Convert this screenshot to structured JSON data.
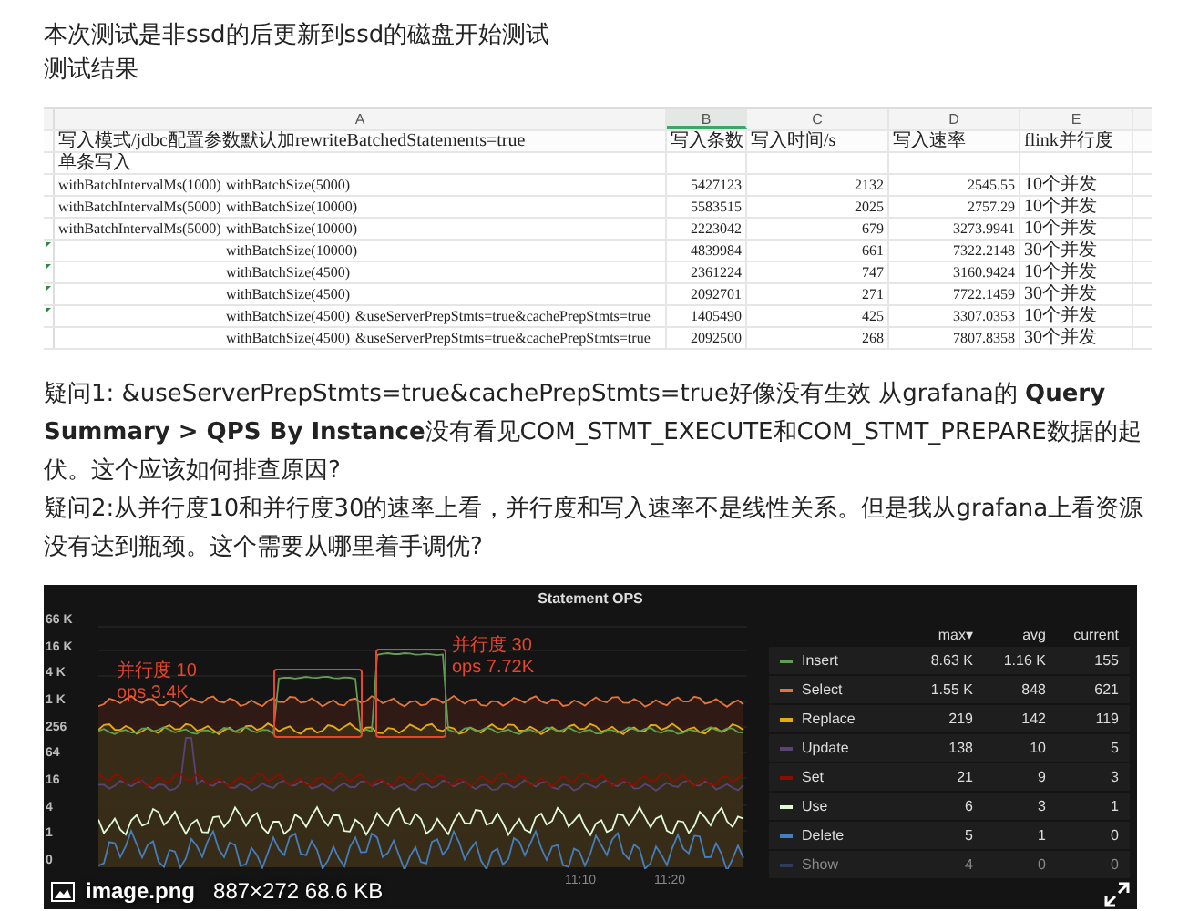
{
  "intro": [
    "本次测试是非ssd的后更新到ssd的磁盘开始测试",
    "测试结果"
  ],
  "sheet": {
    "columns": [
      {
        "label": "A",
        "selected": false
      },
      {
        "label": "B",
        "selected": true
      },
      {
        "label": "C",
        "selected": false
      },
      {
        "label": "D",
        "selected": false
      },
      {
        "label": "E",
        "selected": false
      }
    ],
    "rows": [
      {
        "flagged": false,
        "a": {
          "title": "写入模式/jdbc配置参数默认加rewriteBatchedStatements=true"
        },
        "b": "写入条数",
        "c": "写入时间/s",
        "d": "写入速率",
        "e": "flink并行度",
        "header": true
      },
      {
        "flagged": false,
        "a": {
          "title": "单条写入"
        }
      },
      {
        "flagged": false,
        "a": {
          "interval": "withBatchIntervalMs(1000)",
          "batch": "withBatchSize(5000)"
        },
        "b": "5427123",
        "c": "2132",
        "d": "2545.55",
        "e": "10个并发"
      },
      {
        "flagged": false,
        "a": {
          "interval": "withBatchIntervalMs(5000)",
          "batch": "withBatchSize(10000)"
        },
        "b": "5583515",
        "c": "2025",
        "d": "2757.29",
        "e": "10个并发"
      },
      {
        "flagged": false,
        "a": {
          "interval": "withBatchIntervalMs(5000)",
          "batch": "withBatchSize(10000)"
        },
        "b": "2223042",
        "c": "679",
        "d": "3273.9941",
        "e": "10个并发"
      },
      {
        "flagged": true,
        "a": {
          "batch": "withBatchSize(10000)"
        },
        "b": "4839984",
        "c": "661",
        "d": "7322.2148",
        "e": "30个并发"
      },
      {
        "flagged": true,
        "a": {
          "batch": "withBatchSize(4500)"
        },
        "b": "2361224",
        "c": "747",
        "d": "3160.9424",
        "e": "10个并发"
      },
      {
        "flagged": true,
        "a": {
          "batch": "withBatchSize(4500)"
        },
        "b": "2092701",
        "c": "271",
        "d": "7722.1459",
        "e": "30个并发"
      },
      {
        "flagged": true,
        "a": {
          "batch": "withBatchSize(4500)",
          "options": "&useServerPrepStmts=true&cachePrepStmts=true"
        },
        "b": "1405490",
        "c": "425",
        "d": "3307.0353",
        "e": "10个并发"
      },
      {
        "flagged": false,
        "a": {
          "batch": "withBatchSize(4500)",
          "options": "&useServerPrepStmts=true&cachePrepStmts=true"
        },
        "b": "2092500",
        "c": "268",
        "d": "7807.8358",
        "e": "30个并发"
      }
    ]
  },
  "questions": [
    "疑问1: &useServerPrepStmts=true&cachePrepStmts=true好像没有生效 从grafana的 **Query Summary > QPS By Instance**没有看见COM_STMT_EXECUTE和COM_STMT_PREPARE数据的起伏。这个应该如何排查原因?",
    "疑问2:从并行度10和并行度30的速率上看，并行度和写入速率不是线性关系。但是我从grafana上看资源没有达到瓶颈。这个需要从哪里着手调优?"
  ],
  "panel": {
    "title": "Statement OPS",
    "y_labels": [
      "66 K",
      "16 K",
      "4 K",
      "1 K",
      "256",
      "64",
      "16",
      "4",
      "1",
      "0"
    ],
    "x_labels": [
      "11:10",
      "11:20"
    ],
    "annotations": [
      {
        "lines": [
          "并行度 10",
          "ops 3.4K"
        ]
      },
      {
        "lines": [
          "并行度 30",
          "ops 7.72K"
        ]
      }
    ],
    "legend_columns": [
      "max▾",
      "avg",
      "current"
    ],
    "legend": [
      {
        "name": "Insert",
        "color": "#629e51",
        "max": "8.63 K",
        "avg": "1.16 K",
        "current": "155",
        "dimmed": false
      },
      {
        "name": "Select",
        "color": "#e5743a",
        "max": "1.55 K",
        "avg": "848",
        "current": "621",
        "dimmed": false
      },
      {
        "name": "Replace",
        "color": "#e5ac0e",
        "max": "219",
        "avg": "142",
        "current": "119",
        "dimmed": false
      },
      {
        "name": "Update",
        "color": "#584477",
        "max": "138",
        "avg": "10",
        "current": "5",
        "dimmed": false
      },
      {
        "name": "Set",
        "color": "#890f02",
        "max": "21",
        "avg": "9",
        "current": "3",
        "dimmed": false
      },
      {
        "name": "Use",
        "color": "#e0f9d7",
        "max": "6",
        "avg": "3",
        "current": "1",
        "dimmed": false
      },
      {
        "name": "Delete",
        "color": "#447ebc",
        "max": "5",
        "avg": "1",
        "current": "0",
        "dimmed": false
      },
      {
        "name": "Show",
        "color": "#2f3d5a",
        "max": "4",
        "avg": "0",
        "current": "0",
        "dimmed": true
      }
    ]
  },
  "caption": {
    "filename": "image.png",
    "info": "887×272 68.6 KB"
  }
}
